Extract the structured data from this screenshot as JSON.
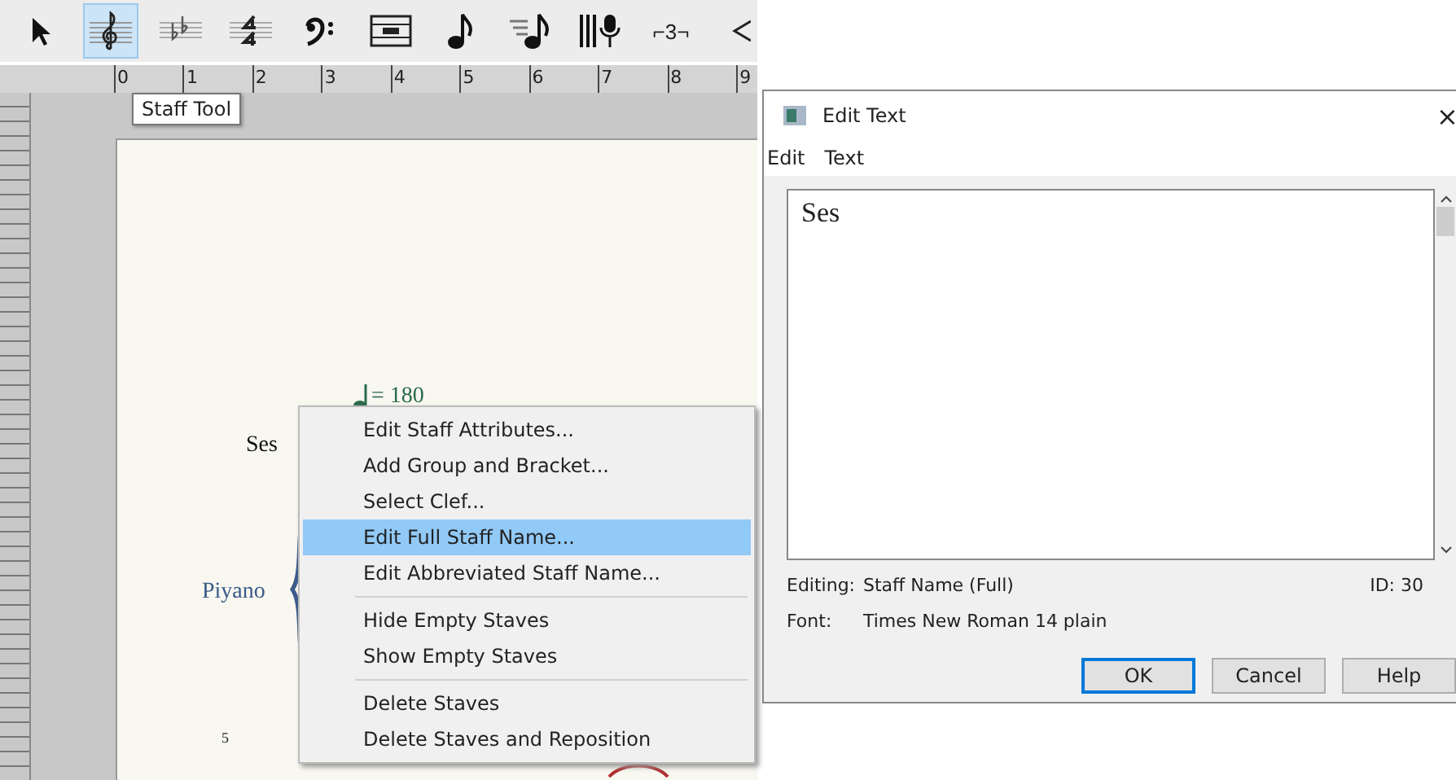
{
  "toolbar": {
    "tools": [
      {
        "kind": "selection",
        "selected": false
      },
      {
        "kind": "staff",
        "selected": true
      },
      {
        "kind": "key",
        "selected": false
      },
      {
        "kind": "time",
        "selected": false
      },
      {
        "kind": "clef",
        "selected": false
      },
      {
        "kind": "measure",
        "selected": false
      },
      {
        "kind": "note",
        "selected": false
      },
      {
        "kind": "speedy",
        "selected": false
      },
      {
        "kind": "mic",
        "selected": false
      },
      {
        "kind": "tuplet",
        "selected": false,
        "label": "⌐3¬"
      },
      {
        "kind": "hairpin",
        "selected": false
      }
    ]
  },
  "ruler": {
    "marks": [
      "0",
      "1",
      "2",
      "3",
      "4",
      "5",
      "6",
      "7",
      "8",
      "9"
    ]
  },
  "tooltip": "Staff Tool",
  "score": {
    "tempo": "= 180",
    "staff_names": [
      "Ses",
      "Piyano"
    ],
    "measure_number": "5"
  },
  "context_menu": {
    "groups": [
      [
        {
          "label": "Edit Staff Attributes...",
          "selected": false
        },
        {
          "label": "Add Group and Bracket...",
          "selected": false
        },
        {
          "label": "Select Clef...",
          "selected": false
        },
        {
          "label": "Edit Full Staff Name...",
          "selected": true
        },
        {
          "label": "Edit Abbreviated Staff Name...",
          "selected": false
        }
      ],
      [
        {
          "label": "Hide Empty Staves",
          "selected": false
        },
        {
          "label": "Show Empty Staves",
          "selected": false
        }
      ],
      [
        {
          "label": "Delete Staves",
          "selected": false
        },
        {
          "label": "Delete Staves and Reposition",
          "selected": false
        }
      ]
    ]
  },
  "dialog": {
    "title": "Edit Text",
    "close": "×",
    "menu": [
      "Edit",
      "Text"
    ],
    "text": "Ses",
    "editing_label": "Editing:",
    "editing_value": "Staff Name (Full)",
    "id": "ID: 30",
    "font_label": "Font:",
    "font_value": "Times New Roman 14 plain",
    "buttons": [
      {
        "label": "OK",
        "default": true
      },
      {
        "label": "Cancel",
        "default": false
      },
      {
        "label": "Help",
        "default": false
      }
    ]
  }
}
